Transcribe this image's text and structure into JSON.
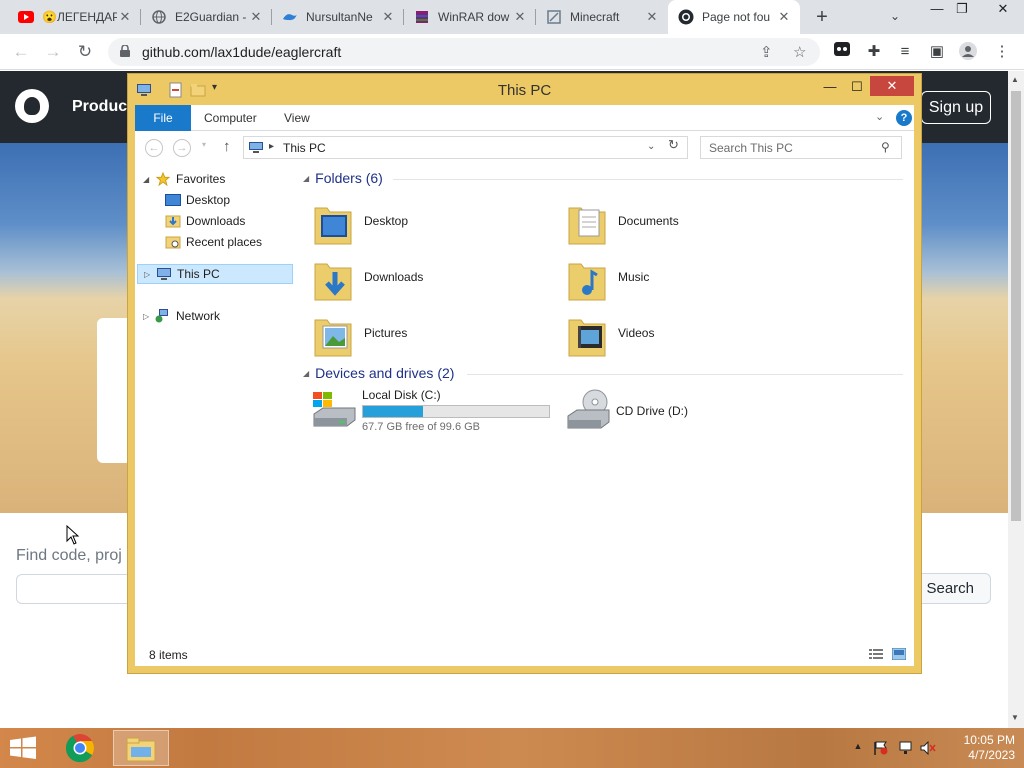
{
  "browser": {
    "tabs": [
      {
        "title": "😮ЛЕГЕНДАР",
        "icon": "youtube-icon"
      },
      {
        "title": "E2Guardian -",
        "icon": "globe-icon"
      },
      {
        "title": "NursultanNe",
        "icon": "nursultan-icon"
      },
      {
        "title": "WinRAR dow",
        "icon": "winrar-icon"
      },
      {
        "title": "Minecraft",
        "icon": "minecraft-icon"
      },
      {
        "title": "Page not fou",
        "icon": "github-icon",
        "active": true
      }
    ],
    "url": "github.com/lax1dude/eaglercraft"
  },
  "github": {
    "products_label": "Product",
    "signup_label": "Sign up",
    "find_placeholder": "Find code, proj",
    "search_button": "Search"
  },
  "explorer": {
    "title": "This PC",
    "ribbon": {
      "file": "File",
      "tabs": [
        "Computer",
        "View"
      ]
    },
    "address": {
      "crumb": "This PC"
    },
    "search_placeholder": "Search This PC",
    "nav": {
      "favorites": "Favorites",
      "favorite_items": [
        "Desktop",
        "Downloads",
        "Recent places"
      ],
      "this_pc": "This PC",
      "network": "Network"
    },
    "folders_header": "Folders (6)",
    "folders": [
      {
        "name": "Desktop",
        "icon": "desktop-folder-icon"
      },
      {
        "name": "Documents",
        "icon": "documents-folder-icon"
      },
      {
        "name": "Downloads",
        "icon": "downloads-folder-icon"
      },
      {
        "name": "Music",
        "icon": "music-folder-icon"
      },
      {
        "name": "Pictures",
        "icon": "pictures-folder-icon"
      },
      {
        "name": "Videos",
        "icon": "videos-folder-icon"
      }
    ],
    "drives_header": "Devices and drives (2)",
    "drives": [
      {
        "name": "Local Disk (C:)",
        "free": "67.7 GB free of 99.6 GB",
        "used_fraction": 0.32,
        "icon": "hard-drive-icon"
      },
      {
        "name": "CD Drive (D:)",
        "icon": "cd-drive-icon"
      }
    ],
    "status_count": "8 items"
  },
  "taskbar": {
    "time": "10:05 PM",
    "date": "4/7/2023"
  },
  "colors": {
    "explorer_frame": "#ecc965",
    "accent_blue": "#1979ca",
    "drive_fill": "#26a0da",
    "close_red": "#c7463d"
  }
}
